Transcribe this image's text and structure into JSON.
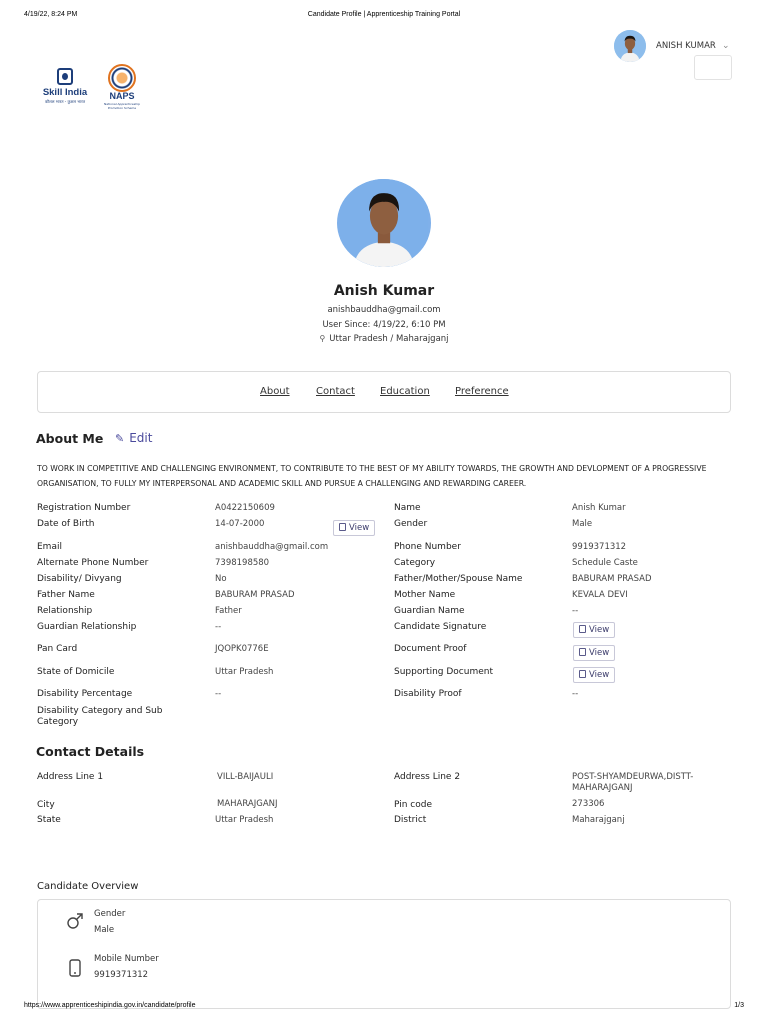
{
  "print": {
    "datetime": "4/19/22, 8:24 PM",
    "title": "Candidate Profile | Apprenticeship Training Portal",
    "url": "https://www.apprenticeshipindia.gov.in/candidate/profile",
    "page": "1/3"
  },
  "logos": {
    "skill_india": "Skill India",
    "skill_india_tagline": "कौशल भारत - कुशल भारत",
    "naps": "NAPS",
    "naps_tagline": "National Apprenticeship Promotion Scheme"
  },
  "header": {
    "user_name": "ANISH KUMAR",
    "chevron_icon": "chevron-down-icon"
  },
  "profile": {
    "name": "Anish Kumar",
    "email": "anishbauddha@gmail.com",
    "user_since": "User Since: 4/19/22, 6:10 PM",
    "location": "Uttar Pradesh / Maharajganj",
    "location_icon": "map-pin-icon"
  },
  "tabs": [
    {
      "label": "About"
    },
    {
      "label": "Contact"
    },
    {
      "label": "Education"
    },
    {
      "label": "Preference"
    }
  ],
  "about": {
    "title": "About Me",
    "edit_label": "Edit",
    "text": "TO WORK IN COMPETITIVE AND CHALLENGING ENVIRONMENT, TO CONTRIBUTE TO THE BEST OF MY ABILITY TOWARDS, THE GROWTH AND DEVLOPMENT OF A PROGRESSIVE ORGANISATION, TO FULLY MY INTERPERSONAL AND ACADEMIC SKILL AND PURSUE A CHALLENGING AND REWARDING CAREER.",
    "left_fields": [
      {
        "label": "Registration Number",
        "value": "A0422150609"
      },
      {
        "label": "Date of Birth",
        "value": "14-07-2000"
      },
      {
        "label": "Email",
        "value": "anishbauddha@gmail.com"
      },
      {
        "label": "Alternate Phone Number",
        "value": "7398198580"
      },
      {
        "label": "Disability/ Divyang",
        "value": "No"
      },
      {
        "label": "Father Name",
        "value": "BABURAM PRASAD"
      },
      {
        "label": "Relationship",
        "value": "Father"
      },
      {
        "label": "Guardian Relationship",
        "value": "--"
      },
      {
        "label": "Pan Card",
        "value": "JQOPK0776E"
      },
      {
        "label": "State of Domicile",
        "value": "Uttar Pradesh"
      },
      {
        "label": "Disability Percentage",
        "value": "--"
      },
      {
        "label": "Disability Category and Sub Category",
        "value": ""
      }
    ],
    "right_fields": [
      {
        "label": "Name",
        "value": "Anish Kumar"
      },
      {
        "label": "Gender",
        "value": "Male"
      },
      {
        "label": "Phone Number",
        "value": "9919371312"
      },
      {
        "label": "Category",
        "value": "Schedule Caste"
      },
      {
        "label": "Father/Mother/Spouse Name",
        "value": "BABURAM PRASAD"
      },
      {
        "label": "Mother Name",
        "value": "KEVALA DEVI"
      },
      {
        "label": "Guardian Name",
        "value": "--"
      },
      {
        "label": "Candidate Signature",
        "value": ""
      },
      {
        "label": "Document Proof",
        "value": ""
      },
      {
        "label": "Supporting Document",
        "value": ""
      },
      {
        "label": "Disability Proof",
        "value": "--"
      }
    ],
    "view_label": "View"
  },
  "contact": {
    "title": "Contact Details",
    "fields": [
      {
        "label": "Address Line 1",
        "value": "VILL-BAIJAULI"
      },
      {
        "label": "Address Line 2",
        "value": "POST-SHYAMDEURWA,DISTT-MAHARAJGANJ"
      },
      {
        "label": "City",
        "value": "MAHARAJGANJ"
      },
      {
        "label": "Pin code",
        "value": "273306"
      },
      {
        "label": "State",
        "value": "Uttar Pradesh"
      },
      {
        "label": "District",
        "value": "Maharajganj"
      }
    ]
  },
  "overview": {
    "title": "Candidate Overview",
    "items": [
      {
        "icon": "male-gender-icon",
        "label": "Gender",
        "value": "Male"
      },
      {
        "icon": "mobile-phone-icon",
        "label": "Mobile Number",
        "value": "9919371312"
      }
    ]
  }
}
